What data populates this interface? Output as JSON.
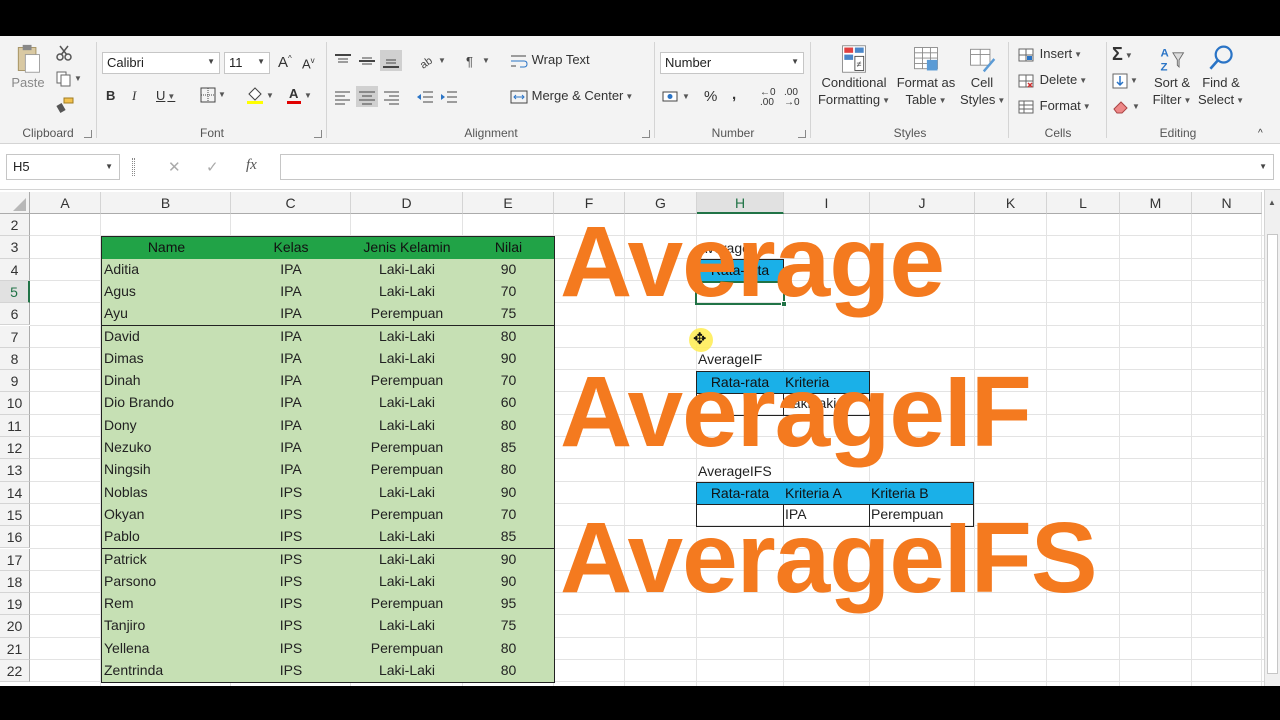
{
  "ribbon": {
    "clipboard": {
      "paste": "Paste",
      "label": "Clipboard"
    },
    "font": {
      "name": "Calibri",
      "size": "11",
      "bold": "B",
      "italic": "I",
      "underline": "U",
      "label": "Font"
    },
    "alignment": {
      "wrap_text": "Wrap Text",
      "merge_center": "Merge & Center",
      "label": "Alignment"
    },
    "number": {
      "format": "Number",
      "percent": "%",
      "comma": ",",
      "label": "Number"
    },
    "styles": {
      "conditional": [
        "Conditional",
        "Formatting"
      ],
      "format_table": [
        "Format as",
        "Table"
      ],
      "cell_styles": [
        "Cell",
        "Styles"
      ],
      "label": "Styles"
    },
    "cells": {
      "insert": "Insert",
      "delete": "Delete",
      "format": "Format",
      "label": "Cells"
    },
    "editing": {
      "sort": [
        "Sort &",
        "Filter"
      ],
      "find": [
        "Find &",
        "Select"
      ],
      "label": "Editing"
    }
  },
  "formula_bar": {
    "name_box": "H5",
    "fx": "fx",
    "cancel": "✕",
    "enter": "✓",
    "content": ""
  },
  "columns": [
    "A",
    "B",
    "C",
    "D",
    "E",
    "F",
    "G",
    "H",
    "I",
    "J",
    "K",
    "L",
    "M",
    "N"
  ],
  "rows": [
    "2",
    "3",
    "4",
    "5",
    "6",
    "7",
    "8",
    "9",
    "10",
    "11",
    "12",
    "13",
    "14",
    "15",
    "16",
    "17",
    "18",
    "19",
    "20",
    "21",
    "22"
  ],
  "table": {
    "headers": [
      "Name",
      "Kelas",
      "Jenis Kelamin",
      "Nilai"
    ],
    "rows": [
      [
        "Aditia",
        "IPA",
        "Laki-Laki",
        "90"
      ],
      [
        "Agus",
        "IPA",
        "Laki-Laki",
        "70"
      ],
      [
        "Ayu",
        "IPA",
        "Perempuan",
        "75"
      ],
      [
        "David",
        "IPA",
        "Laki-Laki",
        "80"
      ],
      [
        "Dimas",
        "IPA",
        "Laki-Laki",
        "90"
      ],
      [
        "Dinah",
        "IPA",
        "Perempuan",
        "70"
      ],
      [
        "Dio Brando",
        "IPA",
        "Laki-Laki",
        "60"
      ],
      [
        "Dony",
        "IPA",
        "Laki-Laki",
        "80"
      ],
      [
        "Nezuko",
        "IPA",
        "Perempuan",
        "85"
      ],
      [
        "Ningsih",
        "IPA",
        "Perempuan",
        "80"
      ],
      [
        "Noblas",
        "IPS",
        "Laki-Laki",
        "90"
      ],
      [
        "Okyan",
        "IPS",
        "Perempuan",
        "70"
      ],
      [
        "Pablo",
        "IPS",
        "Laki-Laki",
        "85"
      ],
      [
        "Patrick",
        "IPS",
        "Laki-Laki",
        "90"
      ],
      [
        "Parsono",
        "IPS",
        "Laki-Laki",
        "90"
      ],
      [
        "Rem",
        "IPS",
        "Perempuan",
        "95"
      ],
      [
        "Tanjiro",
        "IPS",
        "Laki-Laki",
        "75"
      ],
      [
        "Yellena",
        "IPS",
        "Perempuan",
        "80"
      ],
      [
        "Zentrinda",
        "IPS",
        "Laki-Laki",
        "80"
      ]
    ]
  },
  "side": {
    "average_title": "Average",
    "average_header": "Rata-rata",
    "averageif_title": "AverageIF",
    "averageif_headers": [
      "Rata-rata",
      "Kriteria"
    ],
    "averageif_values": [
      "",
      "Laki-laki"
    ],
    "averageifs_title": "AverageIFS",
    "averageifs_headers": [
      "Rata-rata",
      "Kriteria A",
      "Kriteria B"
    ],
    "averageifs_values": [
      "",
      "IPA",
      "Perempuan"
    ]
  },
  "overlay": {
    "line1": "Average",
    "line2": "AverageIF",
    "line3": "AverageIFS",
    "color": "#f47a1f"
  },
  "colors": {
    "header_green": "#21a347",
    "body_green": "#c6e0b4",
    "header_blue": "#1ab0e8",
    "excel_green": "#217346"
  }
}
